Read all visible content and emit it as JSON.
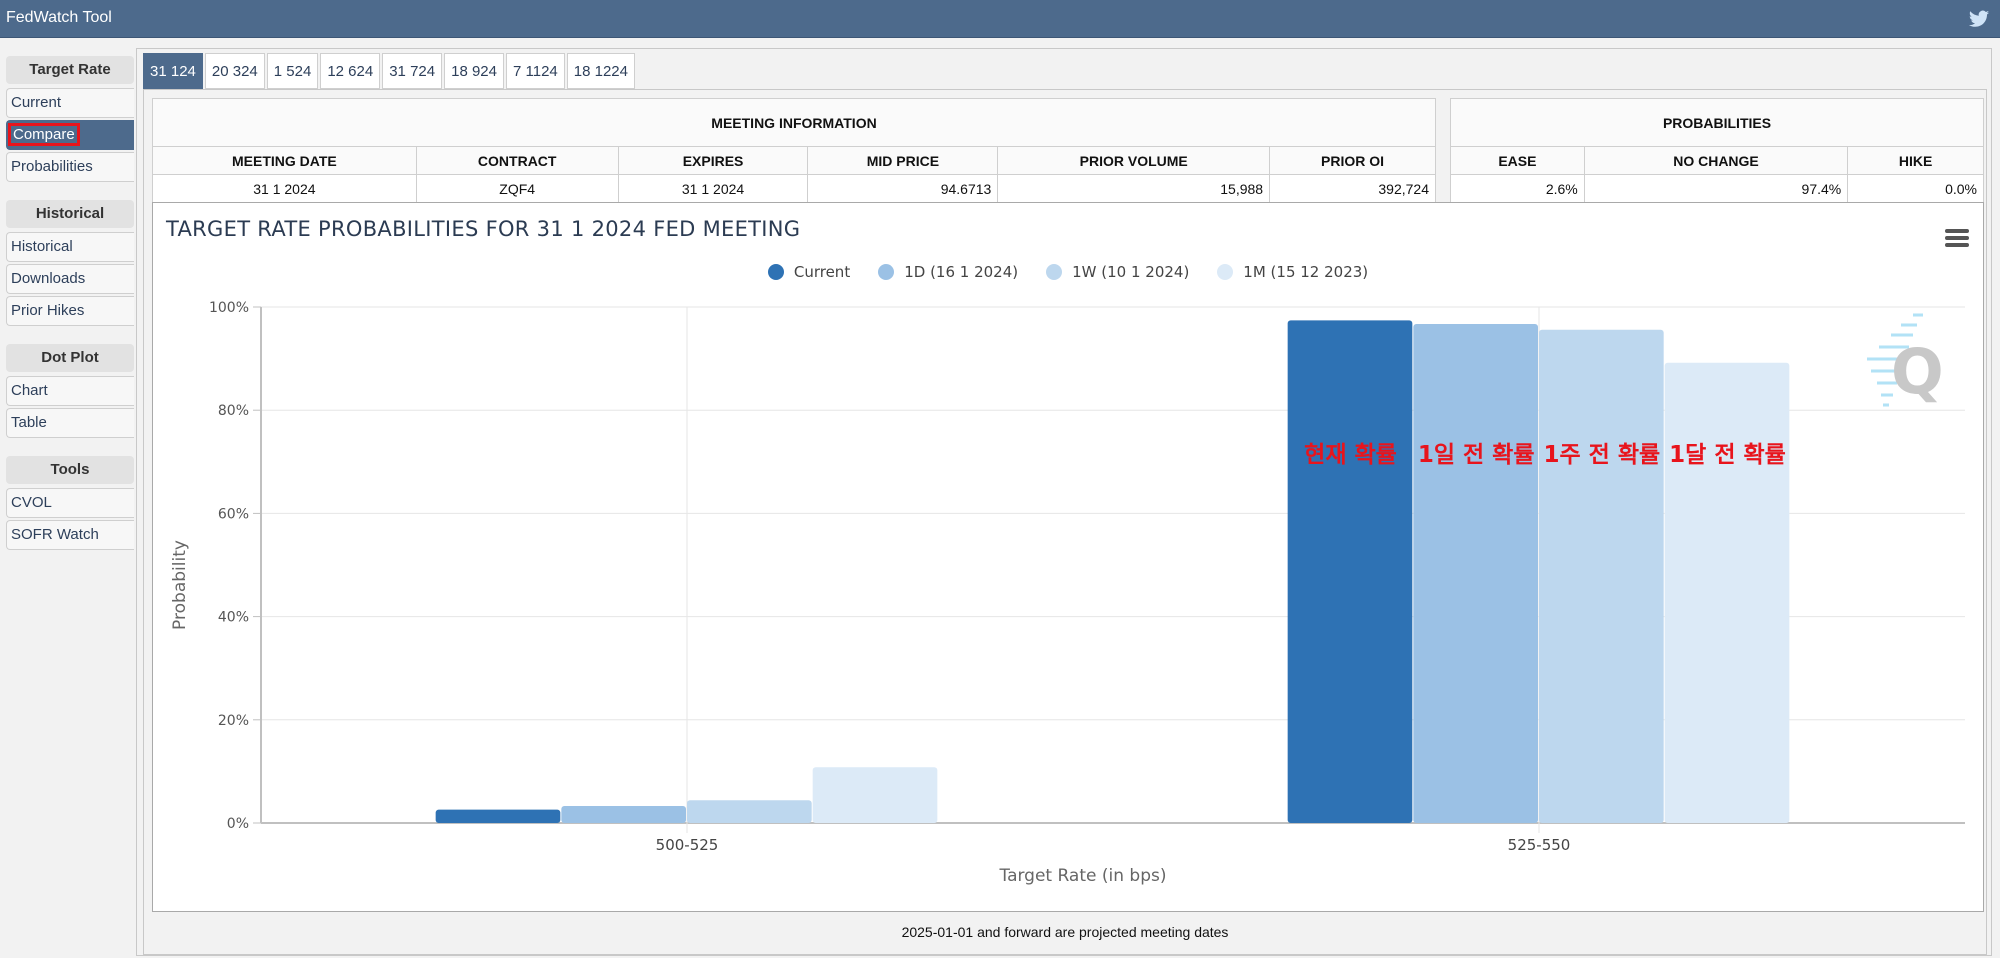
{
  "app": {
    "title": "FedWatch Tool",
    "social_icon": "twitter-bird-icon"
  },
  "sidebar": {
    "sections": [
      {
        "heading": "Target Rate",
        "items": [
          "Current",
          "Compare",
          "Probabilities"
        ]
      },
      {
        "heading": "Historical",
        "items": [
          "Historical",
          "Downloads",
          "Prior Hikes"
        ]
      },
      {
        "heading": "Dot Plot",
        "items": [
          "Chart",
          "Table"
        ]
      },
      {
        "heading": "Tools",
        "items": [
          "CVOL",
          "SOFR Watch"
        ]
      }
    ],
    "active_item": "Compare"
  },
  "tabs": [
    "31 124",
    "20 324",
    "1 524",
    "12 624",
    "31 724",
    "18 924",
    "7 1124",
    "18 1224"
  ],
  "active_tab": "31 124",
  "meeting_info": {
    "heading": "MEETING INFORMATION",
    "columns": [
      "MEETING DATE",
      "CONTRACT",
      "EXPIRES",
      "MID PRICE",
      "PRIOR VOLUME",
      "PRIOR OI"
    ],
    "values": [
      "31 1 2024",
      "ZQF4",
      "31 1 2024",
      "94.6713",
      "15,988",
      "392,724"
    ]
  },
  "probabilities": {
    "heading": "PROBABILITIES",
    "columns": [
      "EASE",
      "NO CHANGE",
      "HIKE"
    ],
    "values": [
      "2.6%",
      "97.4%",
      "0.0%"
    ]
  },
  "chart_menu_icon": "hamburger-menu-icon",
  "watermark": "Q",
  "footnote": "2025-01-01 and forward are projected meeting dates",
  "annotations": [
    "현재 확률",
    "1일 전 확률",
    "1주 전 확률",
    "1달 전 확률"
  ],
  "annotation_color": "#e8141c",
  "chart_data": {
    "type": "bar",
    "title": "TARGET RATE PROBABILITIES FOR 31 1 2024 FED MEETING",
    "xlabel": "Target Rate (in bps)",
    "ylabel": "Probability",
    "categories": [
      "500-525",
      "525-550"
    ],
    "ylim": [
      0,
      100
    ],
    "yticks": [
      "0%",
      "20%",
      "40%",
      "60%",
      "80%",
      "100%"
    ],
    "ytick_values": [
      0,
      20,
      40,
      60,
      80,
      100
    ],
    "grid": true,
    "legend_position": "top-center",
    "series": [
      {
        "name": "Current",
        "color": "#2e72b4",
        "values": [
          2.6,
          97.4
        ]
      },
      {
        "name": "1D (16 1 2024)",
        "color": "#9bc1e5",
        "values": [
          3.3,
          96.7
        ]
      },
      {
        "name": "1W (10 1 2024)",
        "color": "#bdd7ee",
        "values": [
          4.4,
          95.6
        ]
      },
      {
        "name": "1M (15 12 2023)",
        "color": "#dceaf7",
        "values": [
          10.8,
          89.2
        ]
      }
    ]
  }
}
